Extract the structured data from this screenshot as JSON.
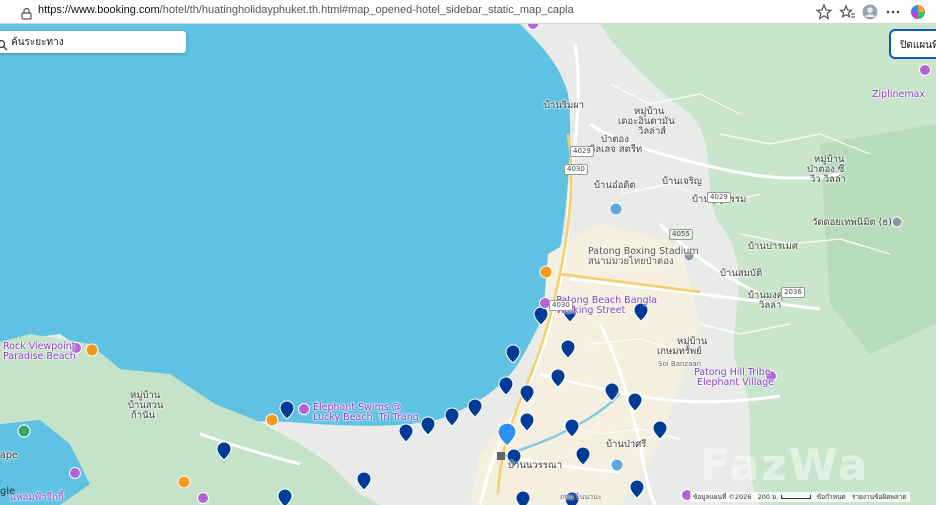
{
  "browser": {
    "url_host": "https://www.booking.com",
    "url_path": "/hotel/th/huatingholidayphuket.th.html#map_opened-hotel_sidebar_static_map_capla"
  },
  "map": {
    "search_placeholder": "ค้นระยะทาง",
    "close_label": "ปิดแผนที่",
    "place_labels": {
      "ban_rimpha": "บ้านริมผา",
      "moo_ban_1": "หมู่บ้าน",
      "dekan": "เดอะอินดามัน",
      "villas": "วิลล่าส์",
      "patong_village": "ป่าตอง",
      "village_street": "วิลเลจ สตรีท",
      "moo_ban_2": "หมู่บ้าน",
      "patong_view": "ป่าตอง ซี",
      "view_villa": "วิว วิลล่า",
      "ban_oad": "บ้านอ๋อดิต",
      "ban_charoen": "บ้านเจริญ",
      "ban_boon": "บ้านบุญธรรม",
      "wat": "วัดดอยเทพนิมิต (ธ)",
      "boxing": "Patong Boxing Stadium",
      "boxing_th": "สนามมวยไทยป่าตอง",
      "ban_prames": "บ้านปารเมศ",
      "ban_sombat": "บ้านสมบัติ",
      "ban_mongkol": "บ้านมงคุล",
      "villa3": "วิลล่า",
      "bangla": "Patong Beach Bangla",
      "walking": "Walking Street",
      "moo_ban_3": "หมู่บ้าน",
      "kasem": "เกษมทรัพย์",
      "rock_view": "Rock Viewpoint",
      "paradise": "Paradise Beach",
      "moo_ban_4": "หมู่บ้าน",
      "ban_suan": "บ้านสวน",
      "kanan": "ก้านัน",
      "elephant_swims": "Elephant Swims @",
      "lucky_beach": "Lucky Beach, Tri Trang",
      "tribe": "Patong Hill Tribe",
      "elephant_village": "Elephant Village",
      "ban_pasri": "บ้านป่าศรี",
      "nanai": "บ้านนวรรณา",
      "cape": "ape",
      "laem": "แหลมฟ้าจีกกี้",
      "zipline": "Ziplinemax",
      "soi_banzaan": "Soi Banzaan",
      "nanai_rd": "ถนน ไนนานะ"
    },
    "route_shields": {
      "r4029a": "4029",
      "r4030a": "4030",
      "r4029b": "4029",
      "r4055": "4055",
      "r2036": "2036",
      "r4030b": "4030",
      "r4055b": "4055",
      "r2036b": "2036"
    },
    "attribution": "ข้อมูลแผนที่ ©2026",
    "scale": "200 ม.",
    "terms": "ข้อกำหนด",
    "report": "รายงานข้อผิดพลาด",
    "google": "gle",
    "watermark": "FazWa"
  }
}
